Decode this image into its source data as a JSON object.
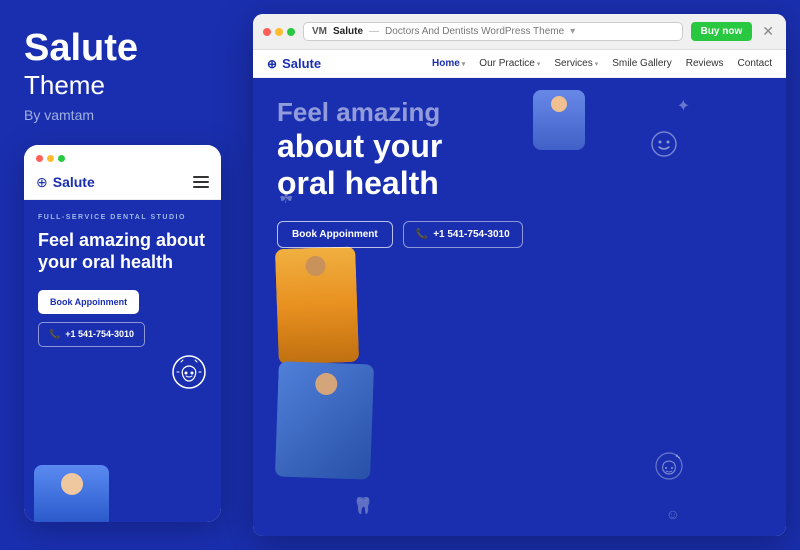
{
  "leftPanel": {
    "brandTitle": "Salute",
    "brandTheme": "Theme",
    "brandBy": "By vamtam"
  },
  "mobileMockup": {
    "dots": [
      "red",
      "yellow",
      "green"
    ],
    "nav": {
      "logoText": "Salute",
      "hamburger": true
    },
    "content": {
      "tag": "Full-Service Dental Studio",
      "headline": "Feel amazing about your oral health",
      "bookBtn": "Book Appoinment",
      "phoneBtn": "+1 541-754-3010"
    }
  },
  "browserWindow": {
    "addressBar": {
      "vLogo": "VM",
      "siteName": "Salute",
      "separator": "—",
      "description": "Doctors And Dentists WordPress Theme",
      "dropdownArrow": "▾"
    },
    "buyNowBtn": "Buy now",
    "closeBtn": "✕",
    "siteNav": {
      "logoText": "Salute",
      "links": [
        {
          "label": "Home",
          "hasArrow": true,
          "active": true
        },
        {
          "label": "Our Practice",
          "hasArrow": true,
          "active": false
        },
        {
          "label": "Services",
          "hasArrow": true,
          "active": false
        },
        {
          "label": "Smile Gallery",
          "hasArrow": false,
          "active": false
        },
        {
          "label": "Reviews",
          "hasArrow": false,
          "active": false
        },
        {
          "label": "Contact",
          "hasArrow": false,
          "active": false
        }
      ]
    },
    "hero": {
      "headlinePartial": "Feel amazing",
      "headlineMain": "about your oral health",
      "bookBtn": "Book Appoinment",
      "phoneBtn": "+1 541-754-3010",
      "decoIcons": [
        "✦",
        "☾",
        "⦿",
        "☺"
      ]
    }
  }
}
